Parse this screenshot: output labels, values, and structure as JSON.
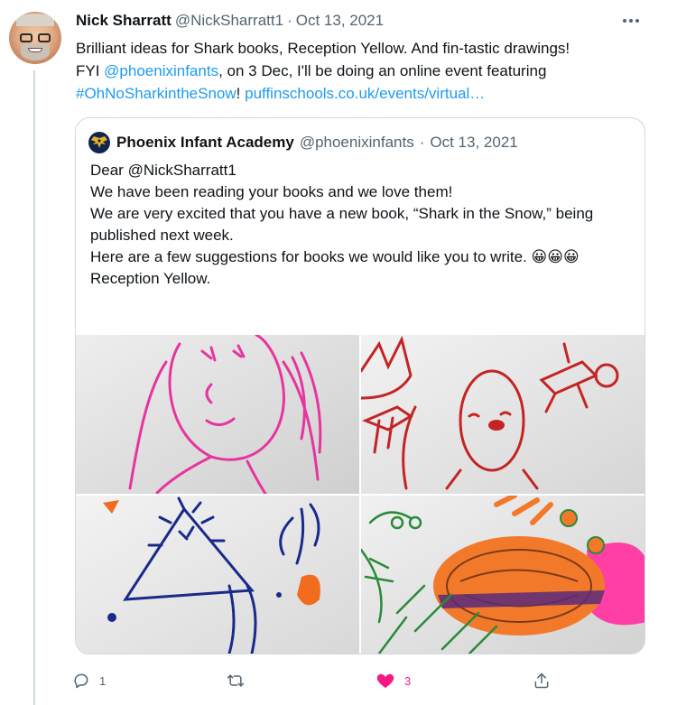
{
  "tweet": {
    "author_name": "Nick Sharratt",
    "author_handle": "@NickSharratt1",
    "separator": "·",
    "date": "Oct 13, 2021",
    "text_line1": "Brilliant ideas for Shark books, Reception Yellow. And fin-tastic drawings!",
    "text_prefix": "FYI ",
    "mention": "@phoenixinfants",
    "text_mid": ", on 3 Dec, I'll be doing an online event featuring",
    "hashtag": "#OhNoSharkintheSnow",
    "text_after_hashtag": "! ",
    "link": "puffinschools.co.uk/events/virtual…"
  },
  "quote": {
    "author_name": "Phoenix Infant Academy",
    "author_handle": "@phoenixinfants",
    "separator": "·",
    "date": "Oct 13, 2021",
    "lines": [
      "Dear @NickSharratt1",
      "We have been reading your books and we love them!",
      "We are very excited that you have a new book, “Shark in the Snow,” being published next week.",
      "Here are a few suggestions for books we would like you to write. 😀😀😀",
      "Reception Yellow."
    ]
  },
  "actions": {
    "reply_count": "1",
    "retweet_count": "",
    "like_count": "3"
  },
  "icons": {
    "reply": "reply-icon",
    "retweet": "retweet-icon",
    "like": "heart-icon",
    "share": "share-icon",
    "more": "more-icon"
  },
  "colors": {
    "accent": "#1d9bf0",
    "like": "#f91880",
    "muted": "#536471",
    "border": "#cfd9de"
  }
}
